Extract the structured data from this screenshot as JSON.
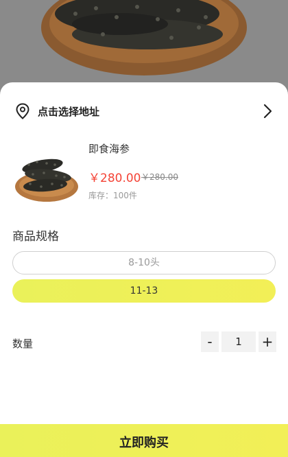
{
  "address": {
    "label": "点击选择地址"
  },
  "product": {
    "name": "即食海参",
    "price": "￥280.00",
    "original_price": "￥280.00",
    "stock": "库存：100件"
  },
  "spec": {
    "title": "商品规格",
    "options": [
      {
        "label": "8-10头",
        "selected": false
      },
      {
        "label": "11-13",
        "selected": true
      }
    ]
  },
  "quantity": {
    "label": "数量",
    "value": "1",
    "minus": "-",
    "plus": "+"
  },
  "buy_button": {
    "label": "立即购买"
  },
  "colors": {
    "accent": "#EEF05A",
    "price": "#F44336",
    "overlay": "#8A8A8A"
  },
  "icons": [
    "location-pin-icon",
    "chevron-right-icon",
    "sea-cucumber-photo"
  ]
}
